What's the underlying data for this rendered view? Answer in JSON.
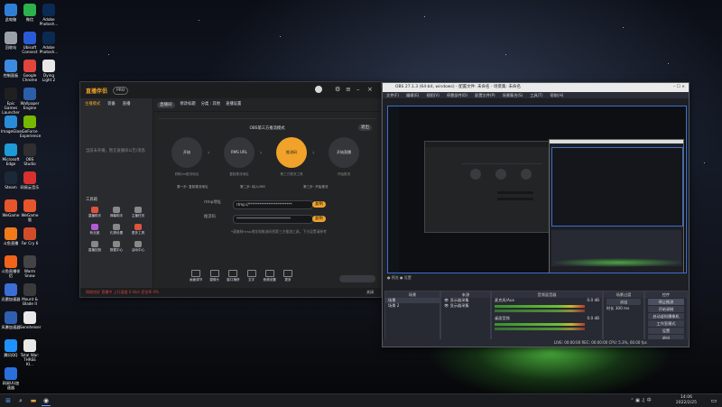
{
  "desktop": {
    "icons_col1": [
      {
        "label": "此电脑",
        "icon": "computer-icon",
        "color": "#2f7fd6"
      },
      {
        "label": "回收站",
        "icon": "recycle-bin-icon",
        "color": "#9aa0a8"
      },
      {
        "label": "控制面板",
        "icon": "control-panel-icon",
        "color": "#3d8be0"
      },
      {
        "label": "Epic Games Launcher",
        "icon": "epic-games-icon",
        "color": "#202020"
      },
      {
        "label": "ImageGlass",
        "icon": "imageglass-icon",
        "color": "#2a8cd6"
      },
      {
        "label": "Microsoft Edge",
        "icon": "edge-icon",
        "color": "#1e9bd7"
      },
      {
        "label": "Steam",
        "icon": "steam-icon",
        "color": "#1b2838"
      },
      {
        "label": "WeGame",
        "icon": "wegame-icon",
        "color": "#e6552b"
      },
      {
        "label": "斗鱼直播",
        "icon": "douyu-icon",
        "color": "#f07a1a"
      },
      {
        "label": "斗鱼直播伴侣",
        "icon": "douyu-companion-icon",
        "color": "#f0641a"
      },
      {
        "label": "迅雷加速器",
        "icon": "accelerator-icon",
        "color": "#3b6ed6"
      },
      {
        "label": "风暴加速器",
        "icon": "storm-icon",
        "color": "#2f5fb0"
      },
      {
        "label": "腾讯QQ",
        "icon": "qq-icon",
        "color": "#1e90ff"
      },
      {
        "label": "网易UU加速器",
        "icon": "uu-icon",
        "color": "#2a6fdb"
      }
    ],
    "icons_col2": [
      {
        "label": "微信",
        "icon": "wechat-icon",
        "color": "#2bb24c"
      },
      {
        "label": "Ubisoft Connect",
        "icon": "ubisoft-icon",
        "color": "#2a5bd7"
      },
      {
        "label": "Google Chrome",
        "icon": "chrome-icon",
        "color": "#e2453c"
      },
      {
        "label": "Wallpaper Engine",
        "icon": "wallpaper-engine-icon",
        "color": "#2d5ea8"
      },
      {
        "label": "GeForce Experience",
        "icon": "geforce-icon",
        "color": "#76b900"
      },
      {
        "label": "OBS Studio",
        "icon": "obs-icon",
        "color": "#302e31"
      },
      {
        "label": "网易云音乐",
        "icon": "netease-music-icon",
        "color": "#d6312f"
      },
      {
        "label": "WeGame版",
        "icon": "wegame-icon",
        "color": "#e6552b"
      },
      {
        "label": "Far Cry 6",
        "icon": "game-icon",
        "color": "#d14d2a"
      },
      {
        "label": "Warm Snow",
        "icon": "game-icon",
        "color": "#444"
      },
      {
        "label": "Mount & Blade II",
        "icon": "game-icon",
        "color": "#3a3a3a"
      },
      {
        "label": "Sennheiser",
        "icon": "file-icon",
        "color": "#e8e8e8"
      },
      {
        "label": "Total War: THREE KI...",
        "icon": "file-icon",
        "color": "#e8e8e8"
      }
    ],
    "icons_col3": [
      {
        "label": "Adobe Photosh...",
        "icon": "photoshop-icon",
        "color": "#0b2a52"
      },
      {
        "label": "Adobe Photosh...",
        "icon": "photoshop-icon",
        "color": "#0b2a52"
      },
      {
        "label": "Dying Light 2",
        "icon": "file-icon",
        "color": "#e8e8e8"
      }
    ]
  },
  "zhibo": {
    "logo": "直播伴侣",
    "version": "PRO",
    "tabs": [
      "主播模式",
      "装备",
      "直播"
    ],
    "header_tag": "直播间",
    "header_items": [
      "修改标题",
      "分类 : 其他",
      "直播设置"
    ],
    "left_placeholder": "当前未开播，暂无直播间公告/消息",
    "toolbox_title": "工具箱",
    "tools": [
      "直播助手",
      "弹幕助手",
      "主播任务",
      "粉丝团",
      "礼物设置",
      "更多工具",
      "直播回放",
      "数据中心",
      "活动中心"
    ],
    "panel_title": "OBS第三方推流模式",
    "panel_button": "退出",
    "nodes": [
      {
        "label": "开始",
        "sub": "获取ivs推流地址"
      },
      {
        "label": "RMS URL",
        "sub": "复制推流地址"
      },
      {
        "label": "推流码",
        "sub": "第三方推流工具"
      },
      {
        "label": "开始直播",
        "sub": "开始推流"
      }
    ],
    "step_text": [
      "第一步: 复制推流地址",
      "第二步: 填入OBS",
      "第三步: 开始推流"
    ],
    "form": [
      {
        "label": "rtmp地址",
        "value": "rtmp://************************",
        "button": "复制"
      },
      {
        "label": "推流码",
        "value": "******************************",
        "button": "复制"
      }
    ],
    "hint": "*请复制rtmp地址和推流码到第三方推流工具，下方设置请参考",
    "bottom_tools": [
      "画面调节",
      "摄像头",
      "窗口捕获",
      "文字",
      "音频设置",
      "更多"
    ],
    "status_left": "网络良好  直播中  上行速度 0 kb/s  丢包率 0%",
    "status_right": "关闭"
  },
  "obs": {
    "title": "OBS 27.1.3 (64-bit, windows) - 配置文件: 未命名 - 场景集: 未命名",
    "menu": [
      "文件(F)",
      "编辑(E)",
      "视图(V)",
      "停靠部件(D)",
      "配置文件(P)",
      "场景集合(S)",
      "工具(T)",
      "帮助(H)"
    ],
    "scenes_title": "场景",
    "scenes": [
      "场景",
      "场景 2"
    ],
    "sources_title": "来源",
    "sources": [
      "显示器采集",
      "显示器采集"
    ],
    "mixer_title": "音频混音器",
    "mixer_channels": [
      {
        "name": "麦克风/Aux",
        "level": "0.0 dB"
      },
      {
        "name": "桌面音频",
        "level": "0.0 dB"
      }
    ],
    "transitions_title": "场景过渡",
    "transition_value": "淡出",
    "duration_label": "时长",
    "duration_value": "300 ms",
    "controls_title": "控件",
    "controls": [
      "停止推流",
      "开始录制",
      "启动虚拟摄像机",
      "工作室模式",
      "设置",
      "退出"
    ],
    "status": "LIVE: 00:00:00   REC: 00:00:00   CPU: 5.3%, 60.00 fps"
  },
  "taskbar": {
    "time": "14:06",
    "date": "2022/2/25"
  }
}
